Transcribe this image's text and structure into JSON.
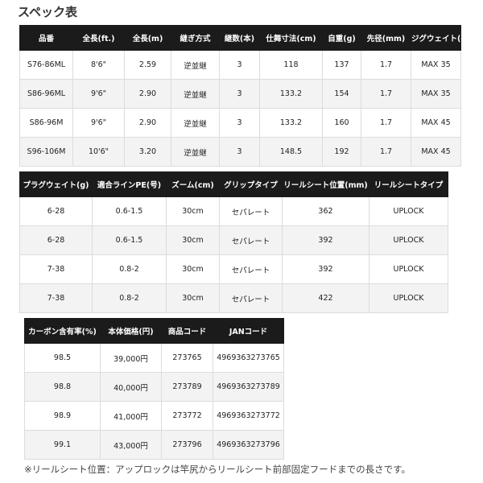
{
  "page_title": "スペック表",
  "table1": {
    "headers": [
      "品番",
      "全長(ft.)",
      "全長(m)",
      "継ぎ方式",
      "継数(本)",
      "仕舞寸法(cm)",
      "自重(g)",
      "先径(mm)",
      "ジグウェイト(g)"
    ],
    "rows": [
      [
        "S76-86ML",
        "8'6\"",
        "2.59",
        "逆並継",
        "3",
        "118",
        "137",
        "1.7",
        "MAX 35"
      ],
      [
        "S86-96ML",
        "9'6\"",
        "2.90",
        "逆並継",
        "3",
        "133.2",
        "154",
        "1.7",
        "MAX 35"
      ],
      [
        "S86-96M",
        "9'6\"",
        "2.90",
        "逆並継",
        "3",
        "133.2",
        "160",
        "1.7",
        "MAX 45"
      ],
      [
        "S96-106M",
        "10'6\"",
        "3.20",
        "逆並継",
        "3",
        "148.5",
        "192",
        "1.7",
        "MAX 45"
      ]
    ]
  },
  "table2": {
    "headers": [
      "プラグウェイト(g)",
      "適合ラインPE(号)",
      "ズーム(cm)",
      "グリップタイプ",
      "リールシート位置(mm)",
      "リールシートタイプ"
    ],
    "rows": [
      [
        "6-28",
        "0.6-1.5",
        "30cm",
        "セパレート",
        "362",
        "UPLOCK"
      ],
      [
        "6-28",
        "0.6-1.5",
        "30cm",
        "セパレート",
        "392",
        "UPLOCK"
      ],
      [
        "7-38",
        "0.8-2",
        "30cm",
        "セパレート",
        "392",
        "UPLOCK"
      ],
      [
        "7-38",
        "0.8-2",
        "30cm",
        "セパレート",
        "422",
        "UPLOCK"
      ]
    ]
  },
  "table3": {
    "headers": [
      "カーボン含有率(%)",
      "本体価格(円)",
      "商品コード",
      "JANコード"
    ],
    "rows": [
      [
        "98.5",
        "39,000円",
        "273765",
        "4969363273765"
      ],
      [
        "98.8",
        "40,000円",
        "273789",
        "4969363273789"
      ],
      [
        "98.9",
        "41,000円",
        "273772",
        "4969363273772"
      ],
      [
        "99.1",
        "43,000円",
        "273796",
        "4969363273796"
      ]
    ]
  },
  "footnote": "※リールシート位置：アップロックは竿尻からリールシート前部固定フードまでの長さです。"
}
